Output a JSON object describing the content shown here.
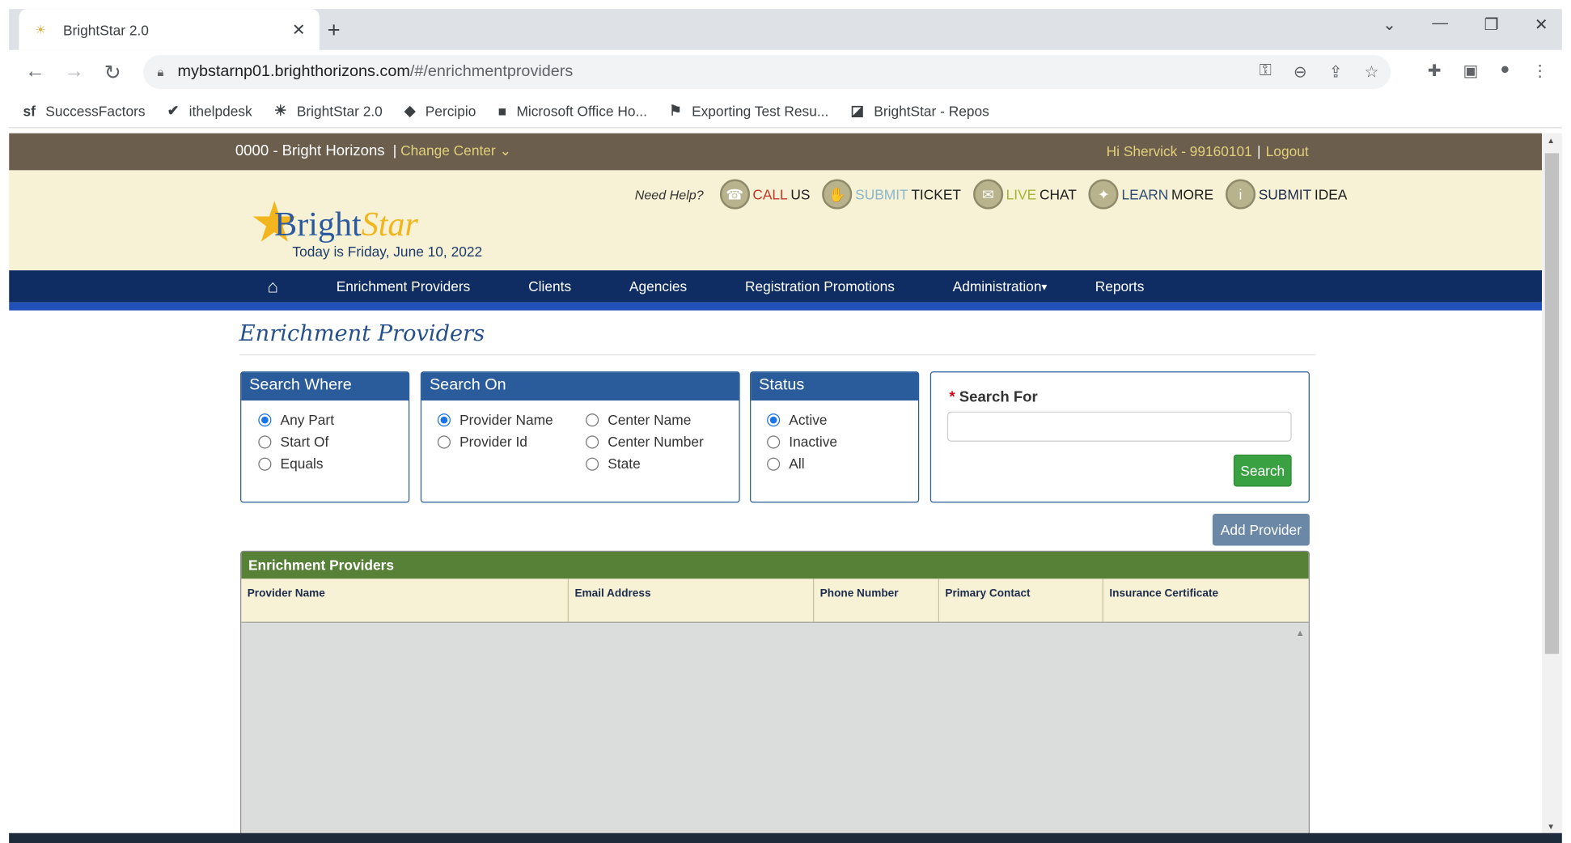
{
  "browser": {
    "tab_title": "BrightStar 2.0",
    "url_host": "mybstarnp01.brighthorizons.com",
    "url_path": "/#/enrichmentproviders",
    "bookmarks": [
      {
        "label": "SuccessFactors",
        "icon": "sf"
      },
      {
        "label": "ithelpdesk",
        "icon": "✔"
      },
      {
        "label": "BrightStar 2.0",
        "icon": "☀"
      },
      {
        "label": "Percipio",
        "icon": "◆"
      },
      {
        "label": "Microsoft Office Ho...",
        "icon": "■"
      },
      {
        "label": "Exporting Test Resu...",
        "icon": "⚑"
      },
      {
        "label": "BrightStar - Repos",
        "icon": "◪"
      }
    ]
  },
  "header": {
    "center_name": "0000 - Bright Horizons",
    "change_center": "Change Center",
    "greeting": "Hi Shervick - 99160101",
    "logout": "Logout"
  },
  "banner": {
    "brand_1": "Bright",
    "brand_2": "Star",
    "today": "Today is Friday, June 10, 2022",
    "need_help": "Need Help?",
    "help_items": [
      {
        "a": "CALL",
        "b": " US"
      },
      {
        "a": "SUBMIT",
        "b": " TICKET"
      },
      {
        "a": "LIVE",
        "b": " CHAT"
      },
      {
        "a": "LEARN",
        "b": " MORE"
      },
      {
        "a": "SUBMIT",
        "b": " IDEA"
      }
    ]
  },
  "nav": {
    "items": [
      "Enrichment Providers",
      "Clients",
      "Agencies",
      "Registration Promotions",
      "Administration",
      "Reports"
    ]
  },
  "page": {
    "title": "Enrichment Providers"
  },
  "search_where": {
    "title": "Search Where",
    "options": [
      "Any Part",
      "Start Of",
      "Equals"
    ],
    "selected": "Any Part"
  },
  "search_on": {
    "title": "Search On",
    "options": [
      "Provider Name",
      "Provider Id",
      "Center Name",
      "Center Number",
      "State"
    ],
    "selected": "Provider Name"
  },
  "status": {
    "title": "Status",
    "options": [
      "Active",
      "Inactive",
      "All"
    ],
    "selected": "Active"
  },
  "search_for": {
    "label": "Search For",
    "required_mark": "*",
    "value": "",
    "button": "Search"
  },
  "add_provider": "Add Provider",
  "grid": {
    "title": "Enrichment Providers",
    "columns": [
      "Provider Name",
      "Email Address",
      "Phone Number",
      "Primary Contact",
      "Insurance Certificate"
    ],
    "rows": []
  },
  "colors": {
    "topbar": "#6b5e4d",
    "banner": "#f7f2d5",
    "nav": "#0f2d63",
    "panel": "#2a5c9b",
    "grid_header": "#578137",
    "search_button": "#3aa143",
    "add_button": "#6b89a7"
  }
}
